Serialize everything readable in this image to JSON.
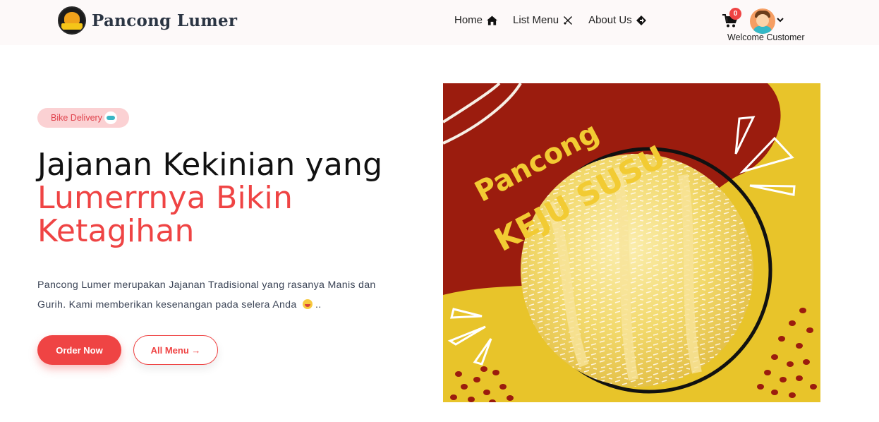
{
  "brand": {
    "name": "Pancong Lumer",
    "logo_icon": "pancong-logo-icon"
  },
  "nav": {
    "items": [
      {
        "label": "Home",
        "icon": "home-icon"
      },
      {
        "label": "List Menu",
        "icon": "utensils-icon"
      },
      {
        "label": "About Us",
        "icon": "direction-sign-icon"
      }
    ]
  },
  "user": {
    "cart_count": "0",
    "welcome": "Welcome Customer",
    "avatar_icon": "user-avatar-icon"
  },
  "hero": {
    "badge_label": "Bike Delivery",
    "title_line1": "Jajanan Kekinian yang",
    "title_line2": "Lumerrnya Bikin",
    "title_line3": "Ketagihan",
    "description": "Pancong Lumer merupakan Jajanan Tradisional yang rasanya Manis dan Gurih. Kami memberikan kesenangan pada selera Anda",
    "description_suffix": "..",
    "order_button": "Order Now",
    "menu_button": "All Menu →",
    "image_text_line1": "Pancong",
    "image_text_line2": "KEJU SUSU"
  },
  "colors": {
    "accent": "#ef4444",
    "heading": "#111111",
    "badge_bg": "#fbd1d3",
    "image_red": "#9b1c0e",
    "image_yellow": "#e8c42a"
  }
}
